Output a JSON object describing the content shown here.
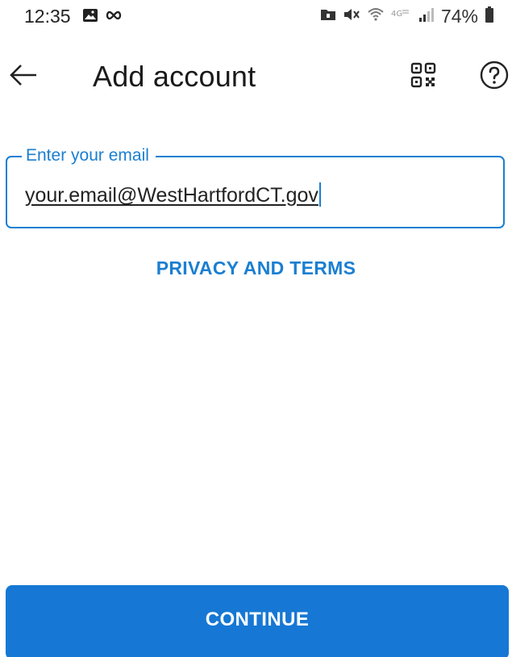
{
  "status_bar": {
    "time": "12:35",
    "battery": "74%",
    "icons": [
      "gallery-icon",
      "infinity-icon",
      "folder-icon",
      "mute-icon",
      "wifi-icon",
      "lte-icon",
      "signal-icon",
      "battery-icon"
    ]
  },
  "app_bar": {
    "title": "Add account",
    "icons": [
      "back-arrow-icon",
      "qr-code-icon",
      "help-icon"
    ]
  },
  "email_field": {
    "label": "Enter your email",
    "value": "your.email@WestHartfordCT.gov"
  },
  "privacy_link": "PRIVACY AND TERMS",
  "continue_button": "CONTINUE",
  "colors": {
    "accent": "#1a7fd1",
    "button": "#1678d4",
    "text": "#1a1a1a"
  }
}
